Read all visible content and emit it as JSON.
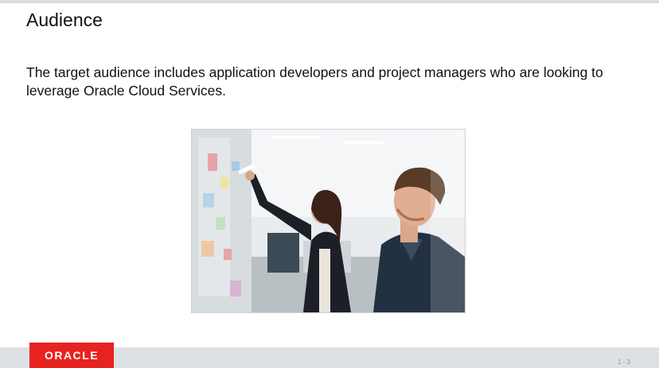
{
  "slide": {
    "title": "Audience",
    "body": "The target audience includes application developers and project managers who are looking to leverage Oracle Cloud Services."
  },
  "photo": {
    "icon": "photo-people-whiteboard"
  },
  "footer": {
    "logo_text": "ORACLE",
    "page_number": "1 - 3"
  },
  "colors": {
    "brand_red": "#e6231e",
    "footer_bg": "#dde1e6",
    "text": "#111111"
  }
}
